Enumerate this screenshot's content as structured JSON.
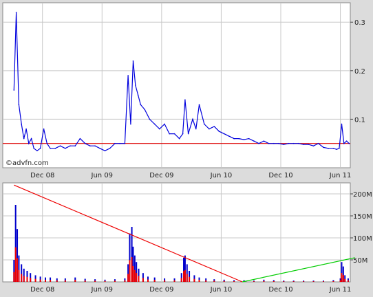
{
  "watermark": "©advfn.com",
  "colors": {
    "background": "#dcdcdc",
    "plot_bg": "#ffffff",
    "grid": "#c8c8c8",
    "price_line": "#0000dd",
    "reference_line": "#dd0000",
    "volume_up": "#0000cc",
    "volume_down": "#ee0000",
    "trend_down": "#ee0000",
    "trend_up": "#00cc00"
  },
  "chart_data": [
    {
      "type": "line",
      "x_ticks": [
        "Dec 08",
        "Jun 09",
        "Dec 09",
        "Jun 10",
        "Dec 10",
        "Jun 11"
      ],
      "x_range": [
        "2008-08",
        "2011-07"
      ],
      "y_ticks": [
        "0.1",
        "0.2",
        "0.3"
      ],
      "ylim": [
        0.0,
        0.34
      ],
      "y_axis_side": "right",
      "grid": true,
      "reference_line": 0.05,
      "series": [
        {
          "x": [
            "2008-09-05",
            "2008-09-12",
            "2008-09-20",
            "2008-09-28",
            "2008-10-05",
            "2008-10-12",
            "2008-10-20",
            "2008-10-28",
            "2008-11-05",
            "2008-11-15",
            "2008-11-25",
            "2008-12-05",
            "2008-12-15",
            "2008-12-25",
            "2009-01-10",
            "2009-01-25",
            "2009-02-10",
            "2009-02-25",
            "2009-03-10",
            "2009-03-25",
            "2009-04-10",
            "2009-04-25",
            "2009-05-10",
            "2009-05-25",
            "2009-06-10",
            "2009-06-25",
            "2009-07-10",
            "2009-07-25",
            "2009-08-10",
            "2009-08-20",
            "2009-08-28",
            "2009-09-05",
            "2009-09-12",
            "2009-09-20",
            "2009-09-28",
            "2009-10-10",
            "2009-10-25",
            "2009-11-10",
            "2009-11-25",
            "2009-12-10",
            "2009-12-25",
            "2010-01-10",
            "2010-01-25",
            "2010-02-05",
            "2010-02-12",
            "2010-02-22",
            "2010-03-05",
            "2010-03-15",
            "2010-03-25",
            "2010-04-10",
            "2010-04-25",
            "2010-05-10",
            "2010-05-25",
            "2010-06-10",
            "2010-06-25",
            "2010-07-10",
            "2010-07-25",
            "2010-08-10",
            "2010-08-25",
            "2010-09-10",
            "2010-09-25",
            "2010-10-10",
            "2010-10-25",
            "2010-11-10",
            "2010-11-25",
            "2010-12-10",
            "2010-12-25",
            "2011-01-10",
            "2011-01-25",
            "2011-02-10",
            "2011-02-25",
            "2011-03-10",
            "2011-03-25",
            "2011-04-10",
            "2011-04-25",
            "2011-05-10",
            "2011-05-20",
            "2011-05-28",
            "2011-06-05",
            "2011-06-12",
            "2011-06-20",
            "2011-06-28"
          ],
          "values": [
            0.16,
            0.32,
            0.13,
            0.09,
            0.06,
            0.08,
            0.05,
            0.06,
            0.04,
            0.035,
            0.04,
            0.08,
            0.05,
            0.04,
            0.04,
            0.045,
            0.04,
            0.045,
            0.045,
            0.06,
            0.05,
            0.045,
            0.045,
            0.04,
            0.035,
            0.04,
            0.05,
            0.05,
            0.05,
            0.19,
            0.09,
            0.22,
            0.17,
            0.15,
            0.13,
            0.12,
            0.1,
            0.09,
            0.08,
            0.09,
            0.07,
            0.07,
            0.06,
            0.07,
            0.14,
            0.07,
            0.1,
            0.08,
            0.13,
            0.09,
            0.08,
            0.085,
            0.075,
            0.07,
            0.065,
            0.06,
            0.06,
            0.058,
            0.06,
            0.055,
            0.05,
            0.055,
            0.05,
            0.05,
            0.05,
            0.048,
            0.05,
            0.05,
            0.05,
            0.048,
            0.048,
            0.045,
            0.05,
            0.042,
            0.04,
            0.04,
            0.038,
            0.04,
            0.09,
            0.05,
            0.055,
            0.05
          ]
        }
      ]
    },
    {
      "type": "bar",
      "x_ticks": [
        "Dec 08",
        "Jun 09",
        "Dec 09",
        "Jun 10",
        "Dec 10",
        "Jun 11"
      ],
      "y_ticks": [
        "50M",
        "100M",
        "150M",
        "200M"
      ],
      "ylim": [
        0,
        225
      ],
      "y_unit": "M",
      "y_axis_side": "right",
      "grid": true,
      "series": [
        {
          "x": [
            "2008-09-05",
            "2008-09-10",
            "2008-09-15",
            "2008-09-20",
            "2008-09-28",
            "2008-10-05",
            "2008-10-15",
            "2008-10-25",
            "2008-11-10",
            "2008-11-25",
            "2008-12-10",
            "2008-12-25",
            "2009-01-15",
            "2009-02-10",
            "2009-03-10",
            "2009-04-10",
            "2009-05-10",
            "2009-06-10",
            "2009-07-10",
            "2009-08-10",
            "2009-08-20",
            "2009-08-25",
            "2009-09-01",
            "2009-09-05",
            "2009-09-10",
            "2009-09-15",
            "2009-09-22",
            "2009-10-05",
            "2009-10-20",
            "2009-11-10",
            "2009-12-10",
            "2010-01-10",
            "2010-02-01",
            "2010-02-08",
            "2010-02-12",
            "2010-02-18",
            "2010-02-25",
            "2010-03-10",
            "2010-03-25",
            "2010-04-15",
            "2010-05-10",
            "2010-06-10",
            "2010-07-10",
            "2010-08-10",
            "2010-09-10",
            "2010-10-10",
            "2010-11-10",
            "2010-12-10",
            "2011-01-10",
            "2011-02-10",
            "2011-03-10",
            "2011-04-10",
            "2011-05-10",
            "2011-06-01",
            "2011-06-05",
            "2011-06-10",
            "2011-06-15",
            "2011-06-25"
          ],
          "values": [
            50,
            175,
            120,
            60,
            40,
            30,
            25,
            20,
            15,
            12,
            10,
            10,
            8,
            8,
            10,
            7,
            6,
            5,
            6,
            8,
            40,
            110,
            125,
            80,
            60,
            45,
            30,
            20,
            12,
            10,
            8,
            8,
            20,
            55,
            60,
            40,
            25,
            15,
            10,
            8,
            6,
            5,
            4,
            4,
            3,
            5,
            4,
            3,
            3,
            3,
            3,
            3,
            4,
            8,
            45,
            35,
            15,
            8
          ]
        }
      ],
      "trend_lines": [
        {
          "color": "red",
          "from": [
            "2008-09-05",
            220
          ],
          "to": [
            "2010-08-05",
            0
          ]
        },
        {
          "color": "green",
          "from": [
            "2010-08-05",
            0
          ],
          "to": [
            "2011-07-15",
            55
          ]
        }
      ]
    }
  ]
}
